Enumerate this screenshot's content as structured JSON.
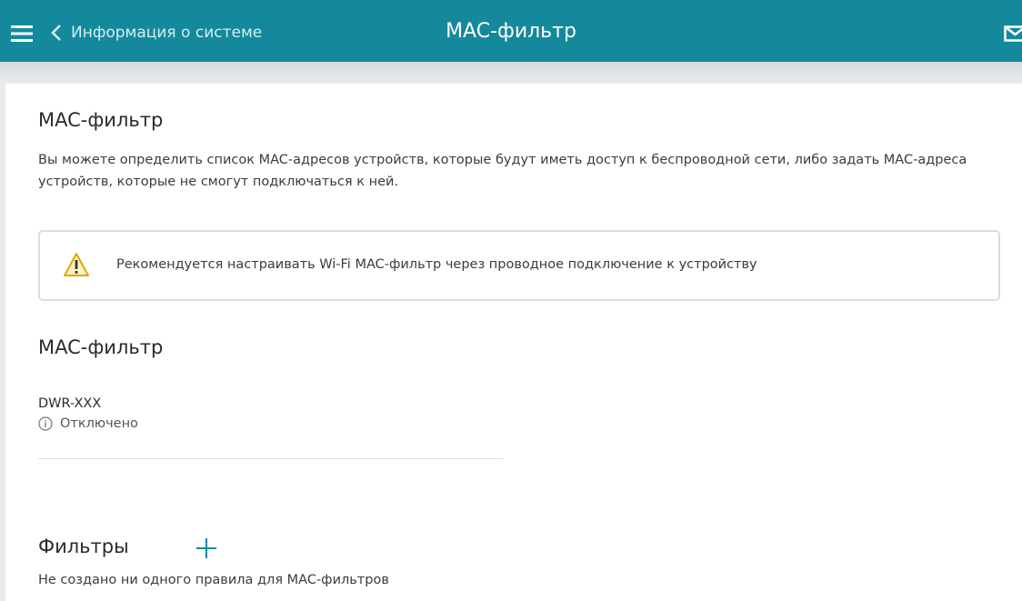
{
  "header": {
    "back_label": "Информация о системе",
    "title": "MAC-фильтр",
    "menu_icon": "hamburger-menu-icon",
    "back_icon": "chevron-left-icon",
    "mail_icon": "mail-icon",
    "color": "#14899b"
  },
  "intro": {
    "title": "MAC-фильтр",
    "description": "Вы можете определить список MAC-адресов устройств, которые будут иметь доступ к беспроводной сети, либо задать MAC-адреса устройств, которые не смогут подключаться к ней."
  },
  "warning": {
    "icon": "warning-triangle-icon",
    "text": "Рекомендуется настраивать Wi-Fi MAC-фильтр через проводное подключение к устройству"
  },
  "mac_filter": {
    "section_title": "MAC-фильтр",
    "device_name": "DWR-XXX",
    "status_icon": "info-icon",
    "status": "Отключено"
  },
  "filters": {
    "section_title": "Фильтры",
    "add_icon": "plus-icon",
    "empty_message": "Не создано ни одного правила для MAC-фильтров"
  }
}
